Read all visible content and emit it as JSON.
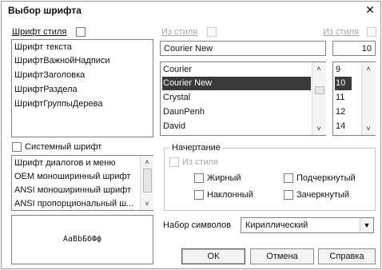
{
  "dialog": {
    "title": "Выбор шрифта",
    "close_glyph": "✕"
  },
  "style_font": {
    "label": "Шрифт стиля",
    "items": [
      "Шрифт текста",
      "ШрифтВажнойНадписи",
      "ШрифтЗаголовка",
      "ШрифтРаздела",
      "ШрифтГруппыДерева"
    ]
  },
  "font_name": {
    "from_style_label": "Из стиля",
    "value": "Courier New",
    "items": [
      "Courier",
      "Courier New",
      "Crystal",
      "DaunPenh",
      "David"
    ],
    "selected_index": 1
  },
  "font_size": {
    "from_style_label": "Из стиля",
    "value": "10",
    "items": [
      "9",
      "10",
      "11",
      "12",
      "14"
    ],
    "selected_index": 1
  },
  "system_font": {
    "label": "Системный шрифт",
    "items": [
      "Шрифт диалогов и меню",
      "OEM моноширинный шрифт",
      "ANSI моноширинный шрифт",
      "ANSI пропорциональный ш..."
    ]
  },
  "preview_text": "AaBbБбФф",
  "style_group": {
    "title": "Начертание",
    "from_style_label": "Из стиля",
    "bold": "Жирный",
    "italic": "Наклонный",
    "underline": "Подчеркнутый",
    "strikethrough": "Зачеркнутый"
  },
  "charset": {
    "label": "Набор символов",
    "value": "Кириллический"
  },
  "buttons": {
    "ok": "ОК",
    "cancel": "Отмена",
    "help": "Справка"
  },
  "glyphs": {
    "up": "▲",
    "down": "▼",
    "caret_up": "˄",
    "caret_down": "˅"
  }
}
